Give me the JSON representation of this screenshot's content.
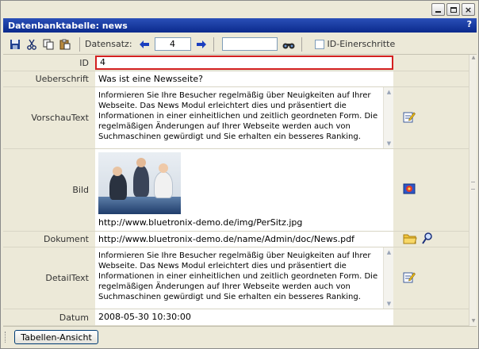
{
  "window": {
    "title": "Datenbanktabelle: news",
    "help_label": "?",
    "controls": {
      "minimize": "",
      "maximize": "",
      "close": "×"
    }
  },
  "toolbar": {
    "record_label": "Datensatz:",
    "record_value": "4",
    "search_value": "",
    "single_step_label": "ID-Einerschritte",
    "single_step_checked": false
  },
  "fields": [
    {
      "key": "id",
      "label": "ID",
      "value": "4"
    },
    {
      "key": "ueberschrift",
      "label": "Ueberschrift",
      "value": "Was ist eine Newsseite?"
    },
    {
      "key": "vorschautext",
      "label": "VorschauText",
      "value": "Informieren Sie Ihre Besucher regelmäßig über Neuigkeiten auf Ihrer Webseite. Das News Modul erleichtert dies und präsentiert die Informationen in einer einheitlichen und zeitlich geordneten Form. Die regelmäßigen Änderungen auf Ihrer Webseite werden auch von Suchmaschinen gewürdigt und Sie erhalten ein besseres Ranking."
    },
    {
      "key": "bild",
      "label": "Bild",
      "value": "http://www.bluetronix-demo.de/img/PerSitz.jpg"
    },
    {
      "key": "dokument",
      "label": "Dokument",
      "value": "http://www.bluetronix-demo.de/name/Admin/doc/News.pdf"
    },
    {
      "key": "detailtext",
      "label": "DetailText",
      "value": "Informieren Sie Ihre Besucher regelmäßig über Neuigkeiten auf Ihrer Webseite. Das News Modul erleichtert dies und präsentiert die Informationen in einer einheitlichen und zeitlich geordneten Form. Die regelmäßigen Änderungen auf Ihrer Webseite werden auch von Suchmaschinen gewürdigt und Sie erhalten ein besseres Ranking."
    },
    {
      "key": "datum",
      "label": "Datum",
      "value": "2008-05-30 10:30:00"
    }
  ],
  "icons": {
    "save": "save-icon",
    "cut": "cut-icon",
    "copy": "copy-icon",
    "paste": "paste-icon",
    "prev": "arrow-left-icon",
    "next": "arrow-right-icon",
    "search": "binoculars-icon",
    "edit": "edit-icon",
    "image": "image-picker-icon",
    "folder": "folder-icon",
    "lookup": "magnifier-icon"
  },
  "colors": {
    "titlebar": "#0b2a8c",
    "required_border": "#d32020",
    "panel": "#ece9d8"
  },
  "footer": {
    "table_view_label": "Tabellen-Ansicht"
  }
}
